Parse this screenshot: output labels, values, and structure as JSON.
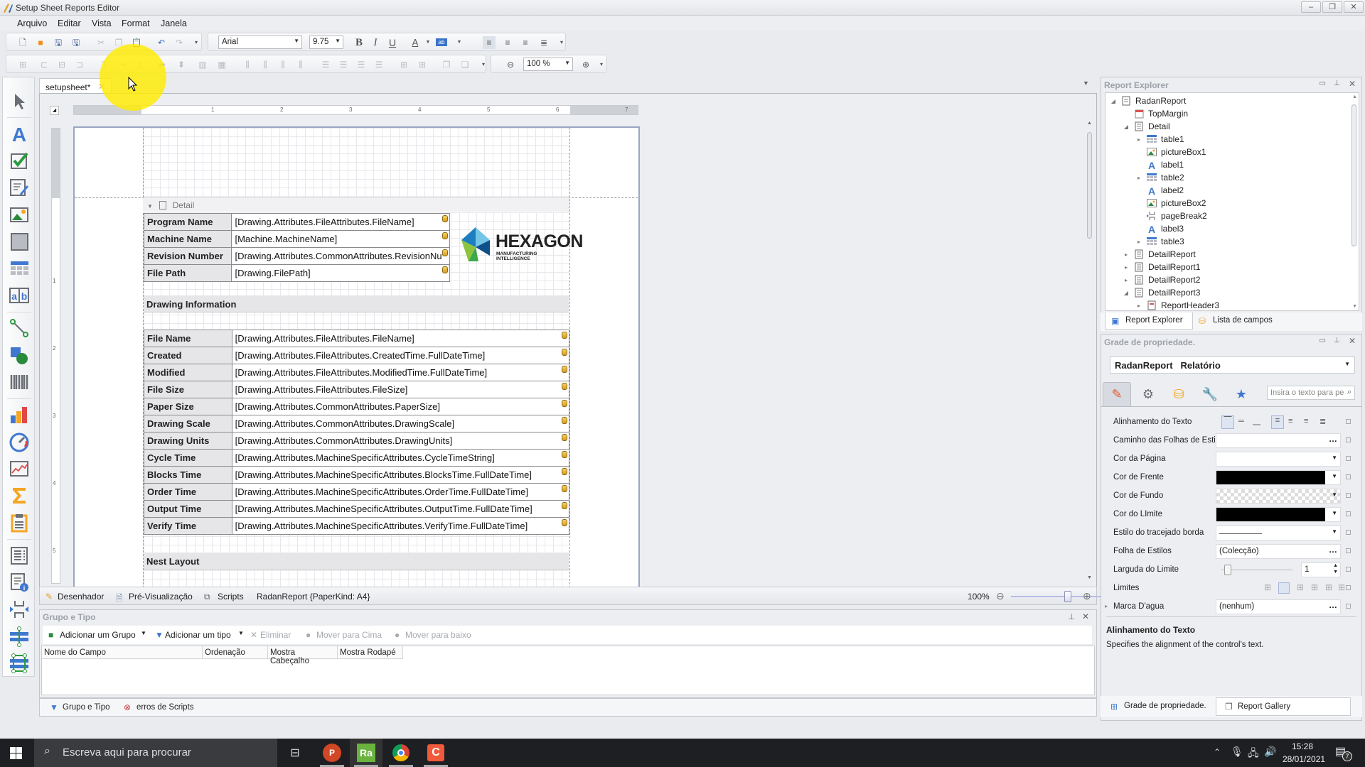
{
  "window": {
    "title": "Setup Sheet Reports Editor",
    "controls": {
      "minimize": "–",
      "restore": "❐",
      "close": "✕"
    }
  },
  "menu": [
    "Arquivo",
    "Editar",
    "Vista",
    "Format",
    "Janela"
  ],
  "toolbar": {
    "font_name": "Arial",
    "font_size": "9.75",
    "bold": "B",
    "italic": "I",
    "underline": "U",
    "font_color": "A",
    "back_color": "ab",
    "zoom": "100 %"
  },
  "document_tab": {
    "label": "setupsheet*",
    "close": "✕"
  },
  "ruler": {
    "ticks": [
      "1",
      "2",
      "3",
      "4",
      "5",
      "6",
      "7"
    ],
    "vticks": [
      "1",
      "2",
      "3",
      "4",
      "5"
    ]
  },
  "report": {
    "band_label": "Detail",
    "header_table": [
      {
        "label": "Program Name",
        "value": "[Drawing.Attributes.FileAttributes.FileName]"
      },
      {
        "label": "Machine Name",
        "value": "[Machine.MachineName]"
      },
      {
        "label": "Revision Number",
        "value": "[Drawing.Attributes.CommonAttributes.RevisionNu"
      },
      {
        "label": "File Path",
        "value": "[Drawing.FilePath]"
      }
    ],
    "logo": {
      "brand": "HEXAGON",
      "tagline": "MANUFACTURING INTELLIGENCE"
    },
    "section1_title": "Drawing Information",
    "info_table": [
      {
        "label": "File Name",
        "value": "[Drawing.Attributes.FileAttributes.FileName]"
      },
      {
        "label": "Created",
        "value": "[Drawing.Attributes.FileAttributes.CreatedTime.FullDateTime]"
      },
      {
        "label": "Modified",
        "value": "[Drawing.Attributes.FileAttributes.ModifiedTime.FullDateTime]"
      },
      {
        "label": "File Size",
        "value": "[Drawing.Attributes.FileAttributes.FileSize]"
      },
      {
        "label": "Paper Size",
        "value": "[Drawing.Attributes.CommonAttributes.PaperSize]"
      },
      {
        "label": "Drawing Scale",
        "value": "[Drawing.Attributes.CommonAttributes.DrawingScale]"
      },
      {
        "label": "Drawing Units",
        "value": "[Drawing.Attributes.CommonAttributes.DrawingUnits]"
      },
      {
        "label": "Cycle Time",
        "value": "[Drawing.Attributes.MachineSpecificAttributes.CycleTimeString]"
      },
      {
        "label": "Blocks Time",
        "value": "[Drawing.Attributes.MachineSpecificAttributes.BlocksTime.FullDateTime]"
      },
      {
        "label": "Order Time",
        "value": "[Drawing.Attributes.MachineSpecificAttributes.OrderTime.FullDateTime]"
      },
      {
        "label": "Output Time",
        "value": "[Drawing.Attributes.MachineSpecificAttributes.OutputTime.FullDateTime]"
      },
      {
        "label": "Verify Time",
        "value": "[Drawing.Attributes.MachineSpecificAttributes.VerifyTime.FullDateTime]"
      }
    ],
    "section2_title": "Nest Layout"
  },
  "designer_status": {
    "designer_tab": "Desenhador",
    "preview_tab": "Pré-Visualização",
    "scripts_tab": "Scripts",
    "report_info": "RadanReport {PaperKind: A4}",
    "zoom": "100%",
    "zoom_level_percent": 100
  },
  "group_panel": {
    "title": "Grupo e Tipo",
    "buttons": {
      "add_group": "Adicionar um Grupo",
      "add_sort": "Adicionar um tipo",
      "delete": "Eliminar",
      "move_up": "Mover para Cima",
      "move_down": "Mover para baixo"
    },
    "columns": [
      "Nome do Campo",
      "Ordenação",
      "Mostra Cabeçalho",
      "Mostra Rodapé"
    ],
    "tabs": [
      "Grupo e Tipo",
      "erros de Scripts"
    ]
  },
  "report_explorer": {
    "title": "Report Explorer",
    "tree": [
      {
        "label": "RadanReport",
        "level": 0,
        "toggle": "expanded",
        "icon": "report-icon"
      },
      {
        "label": "TopMargin",
        "level": 1,
        "toggle": "none",
        "icon": "margin-band-icon"
      },
      {
        "label": "Detail",
        "level": 1,
        "toggle": "expanded",
        "icon": "band-icon"
      },
      {
        "label": "table1",
        "level": 2,
        "toggle": "collapsed",
        "icon": "table-icon"
      },
      {
        "label": "pictureBox1",
        "level": 2,
        "toggle": "none",
        "icon": "picture-icon"
      },
      {
        "label": "label1",
        "level": 2,
        "toggle": "none",
        "icon": "label-icon"
      },
      {
        "label": "table2",
        "level": 2,
        "toggle": "collapsed",
        "icon": "table-icon"
      },
      {
        "label": "label2",
        "level": 2,
        "toggle": "none",
        "icon": "label-icon"
      },
      {
        "label": "pictureBox2",
        "level": 2,
        "toggle": "none",
        "icon": "picture-icon"
      },
      {
        "label": "pageBreak2",
        "level": 2,
        "toggle": "none",
        "icon": "page-break-icon"
      },
      {
        "label": "label3",
        "level": 2,
        "toggle": "none",
        "icon": "label-icon"
      },
      {
        "label": "table3",
        "level": 2,
        "toggle": "collapsed",
        "icon": "table-icon"
      },
      {
        "label": "DetailReport",
        "level": 1,
        "toggle": "collapsed",
        "icon": "band-icon"
      },
      {
        "label": "DetailReport1",
        "level": 1,
        "toggle": "collapsed",
        "icon": "band-icon"
      },
      {
        "label": "DetailReport2",
        "level": 1,
        "toggle": "collapsed",
        "icon": "band-icon"
      },
      {
        "label": "DetailReport3",
        "level": 1,
        "toggle": "expanded",
        "icon": "band-icon"
      },
      {
        "label": "ReportHeader3",
        "level": 2,
        "toggle": "collapsed",
        "icon": "header-band-icon"
      }
    ],
    "tabs": [
      "Report Explorer",
      "Lista de campos"
    ]
  },
  "property_grid": {
    "title": "Grade de propriedade.",
    "object_name": "RadanReport",
    "object_type": "Relatório",
    "search_placeholder": "Insira o texto para pe",
    "properties": [
      {
        "name": "Alinhamento do Texto",
        "kind": "align"
      },
      {
        "name": "Caminho das Folhas de Estilo",
        "kind": "ellipsis",
        "value": ""
      },
      {
        "name": "Cor da Página",
        "kind": "dropdown",
        "value": ""
      },
      {
        "name": "Cor de Frente",
        "kind": "color",
        "value": "#000000"
      },
      {
        "name": "Cor de Fundo",
        "kind": "transparent",
        "value": ""
      },
      {
        "name": "Cor do LImite",
        "kind": "color",
        "value": "#000000"
      },
      {
        "name": "Estilo do tracejado borda",
        "kind": "line",
        "value": ""
      },
      {
        "name": "Folha de Estilos",
        "kind": "ellipsis",
        "value": "(Colecção)"
      },
      {
        "name": "Larguda do Limite",
        "kind": "spin",
        "value": "1"
      },
      {
        "name": "Limites",
        "kind": "borders"
      },
      {
        "name": "Marca D'agua",
        "kind": "ellipsis",
        "value": "(nenhum)"
      }
    ],
    "description_title": "Alinhamento do Texto",
    "description_text": "Specifies the alignment of the control's text.",
    "tabs": [
      "Grade de propriedade.",
      "Report Gallery"
    ]
  },
  "taskbar": {
    "search_placeholder": "Escreva aqui para procurar",
    "time": "15:28",
    "date": "28/01/2021",
    "notifications": "7",
    "ra_label": "Ra"
  },
  "colors": {
    "accent_blue": "#4a7bd0",
    "label_cell_bg": "#e6e6e8",
    "page_border": "#9aa6c3"
  }
}
